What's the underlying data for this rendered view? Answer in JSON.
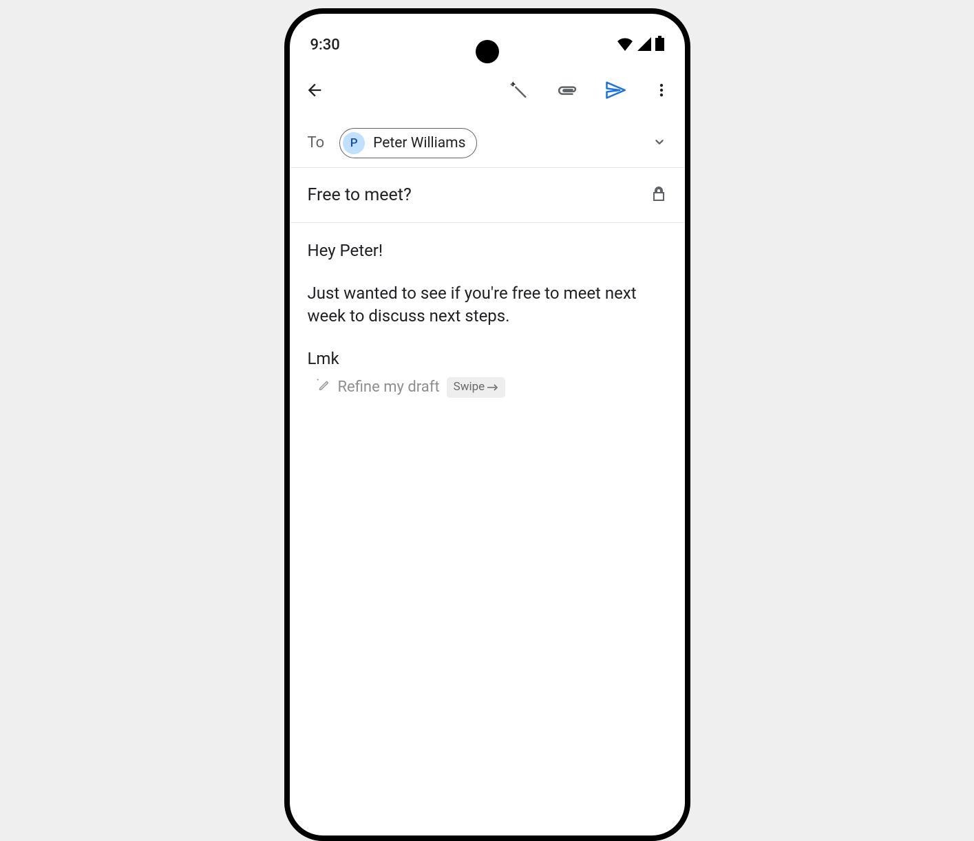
{
  "status": {
    "time": "9:30"
  },
  "compose": {
    "to_label": "To",
    "recipient_name": "Peter Williams",
    "recipient_initial": "P",
    "subject": "Free to meet?",
    "body_line1": "Hey Peter!",
    "body_line2": "Just wanted to see if you're free to meet next week to discuss next steps.",
    "body_line3": "Lmk"
  },
  "refine": {
    "label": "Refine my draft",
    "swipe_label": "Swipe"
  }
}
